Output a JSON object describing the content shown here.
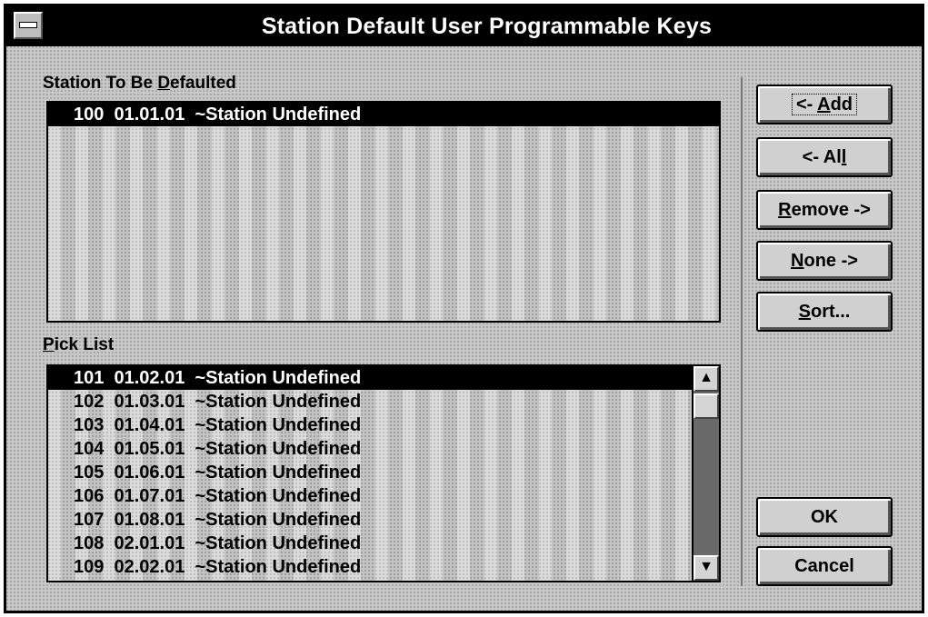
{
  "window": {
    "title": "Station Default User Programmable Keys"
  },
  "station_group": {
    "label_pre": "Station To Be ",
    "label_mnemonic": "D",
    "label_post": "efaulted",
    "items": [
      {
        "text": "100  01.01.01  ~Station Undefined",
        "selected": true
      }
    ]
  },
  "pick_group": {
    "label_mnemonic": "P",
    "label_post": "ick List",
    "items": [
      {
        "text": "101  01.02.01  ~Station Undefined",
        "selected": true
      },
      {
        "text": "102  01.03.01  ~Station Undefined",
        "selected": false
      },
      {
        "text": "103  01.04.01  ~Station Undefined",
        "selected": false
      },
      {
        "text": "104  01.05.01  ~Station Undefined",
        "selected": false
      },
      {
        "text": "105  01.06.01  ~Station Undefined",
        "selected": false
      },
      {
        "text": "106  01.07.01  ~Station Undefined",
        "selected": false
      },
      {
        "text": "107  01.08.01  ~Station Undefined",
        "selected": false
      },
      {
        "text": "108  02.01.01  ~Station Undefined",
        "selected": false
      },
      {
        "text": "109  02.02.01  ~Station Undefined",
        "selected": false
      }
    ],
    "scroll_up_icon": "arrow-up",
    "scroll_down_icon": "arrow-down"
  },
  "buttons": {
    "add": {
      "pre": "<- ",
      "mnemonic": "A",
      "post": "dd"
    },
    "all": {
      "pre": "<- Al",
      "mnemonic": "l",
      "post": ""
    },
    "remove": {
      "pre": "",
      "mnemonic": "R",
      "post": "emove ->"
    },
    "none": {
      "pre": "",
      "mnemonic": "N",
      "post": "one ->"
    },
    "sort": {
      "pre": "",
      "mnemonic": "S",
      "post": "ort..."
    },
    "ok": {
      "label": "OK"
    },
    "cancel": {
      "label": "Cancel"
    }
  }
}
